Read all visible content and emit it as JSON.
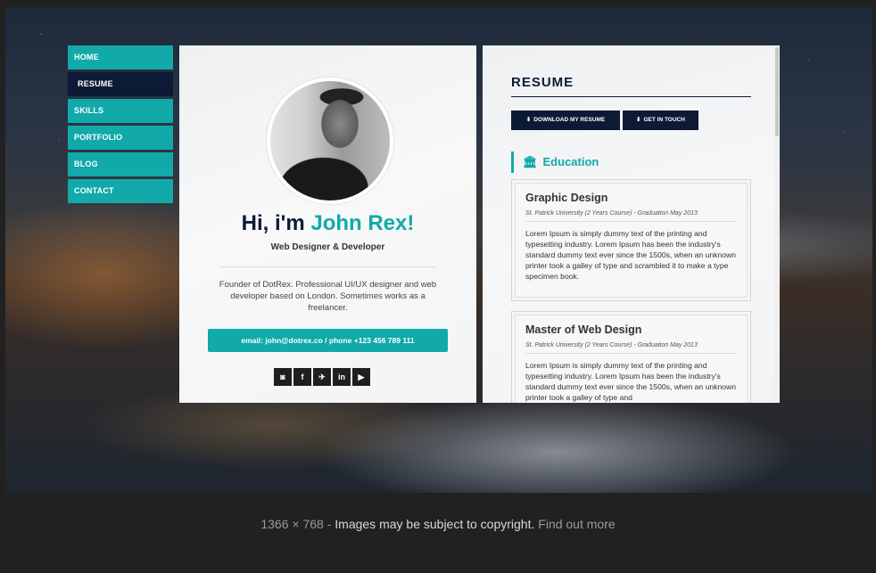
{
  "nav": {
    "items": [
      {
        "label": "HOME"
      },
      {
        "label": "RESUME"
      },
      {
        "label": "SKILLS"
      },
      {
        "label": "PORTFOLIO"
      },
      {
        "label": "BLOG"
      },
      {
        "label": "CONTACT"
      }
    ],
    "active_index": 1
  },
  "profile": {
    "greeting": "Hi, i'm ",
    "name": "John Rex!",
    "role": "Web Designer & Developer",
    "bio": "Founder of DotRex. Professional UI/UX designer and web developer based on London. Sometimes works as a freelancer.",
    "contact": "email: john@dotrex.co / phone +123 456 789 111",
    "social": [
      {
        "icon": "instagram-icon",
        "glyph": "◙"
      },
      {
        "icon": "facebook-icon",
        "glyph": "f"
      },
      {
        "icon": "twitter-icon",
        "glyph": "✈"
      },
      {
        "icon": "linkedin-icon",
        "glyph": "in"
      },
      {
        "icon": "youtube-icon",
        "glyph": "▶"
      }
    ]
  },
  "resume": {
    "title": "RESUME",
    "download_label": "DOWNLOAD MY RESUME",
    "contact_label": "GET IN TOUCH",
    "education_label": "Education",
    "entries": [
      {
        "title": "Graphic Design",
        "meta": "St. Patrick University (2 Years Course) - Graduation May 2013",
        "body": "Lorem Ipsum is simply dummy text of the printing and typesetting industry. Lorem Ipsum has been the industry's standard dummy text ever since the 1500s, when an unknown printer took a galley of type and scrambled it to make a type specimen book."
      },
      {
        "title": "Master of Web Design",
        "meta": "St. Patrick University (2 Years Course) - Graduation May 2013",
        "body": "Lorem Ipsum is simply dummy text of the printing and typesetting industry. Lorem Ipsum has been the industry's standard dummy text ever since the 1500s, when an unknown printer took a galley of type and"
      }
    ]
  },
  "viewer": {
    "dimensions": "1366 × 768",
    "separator": " - ",
    "copyright": "Images may be subject to copyright.",
    "find_out_more": "Find out more"
  },
  "colors": {
    "accent": "#11a9a9",
    "navy": "#0d1a36",
    "viewer_bg": "#212121"
  }
}
